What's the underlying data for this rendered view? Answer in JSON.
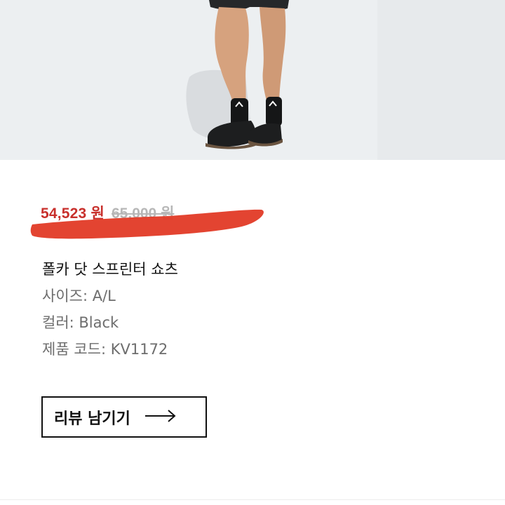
{
  "product": {
    "sale_price": "54,523 원",
    "original_price": "65,000 원",
    "name": "폴카 닷 스프린터 쇼츠",
    "size": "사이즈: A/L",
    "color": "컬러: Black",
    "code": "제품 코드: KV1172"
  },
  "actions": {
    "review_label": "리뷰 남기기"
  },
  "colors": {
    "sale": "#c8302c",
    "scribble": "#e23a26",
    "hero_bg": "#e9ecee"
  },
  "icons": {
    "review_arrow": "arrow-right-icon"
  }
}
